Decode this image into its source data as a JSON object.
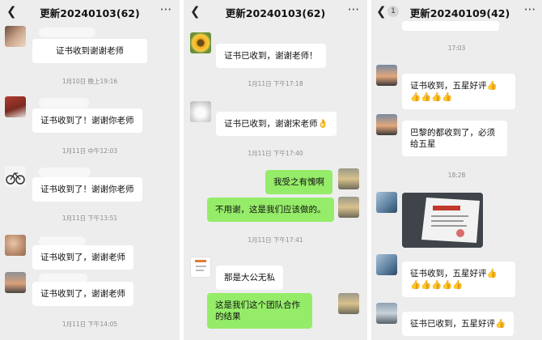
{
  "panel1": {
    "title": "更新20240103(62)",
    "messages": [
      "证书收到谢谢老师",
      "证书收到了！谢谢你老师",
      "证书收到了！谢谢你老师",
      "证书收到了，谢谢老师",
      "证书收到了，谢谢老师"
    ],
    "timestamps": [
      "1月10日 晚上19:16",
      "1月11日 中午12:03",
      "1月11日 下午13:51",
      "1月11日 下午14:05"
    ]
  },
  "panel2": {
    "title": "更新20240103(62)",
    "messages": [
      "证书已收到，谢谢老师！",
      "证书已收到，谢谢宋老师",
      "我受之有愧啊",
      "不用谢，这是我们应该做的。",
      "那是大公无私",
      "这是我们这个团队合作的结果"
    ],
    "emoji": "👌",
    "timestamps": [
      "1月11日 下午17:18",
      "1月11日 下午17:40",
      "1月11日 下午17:41"
    ]
  },
  "panel3": {
    "title": "更新20240109(42)",
    "badge": "1",
    "messages": [
      "证书收到，五星好评",
      "巴黎的都收到了，必须给五星",
      "征书收到，五星好评",
      "征书已收到，五星好评"
    ],
    "thumbs": "👍",
    "timestamps": [
      "17:03",
      "18:28"
    ]
  },
  "colors": {
    "chat_bg": "#ededed",
    "self_bubble": "#95ec69",
    "other_bubble": "#ffffff"
  }
}
